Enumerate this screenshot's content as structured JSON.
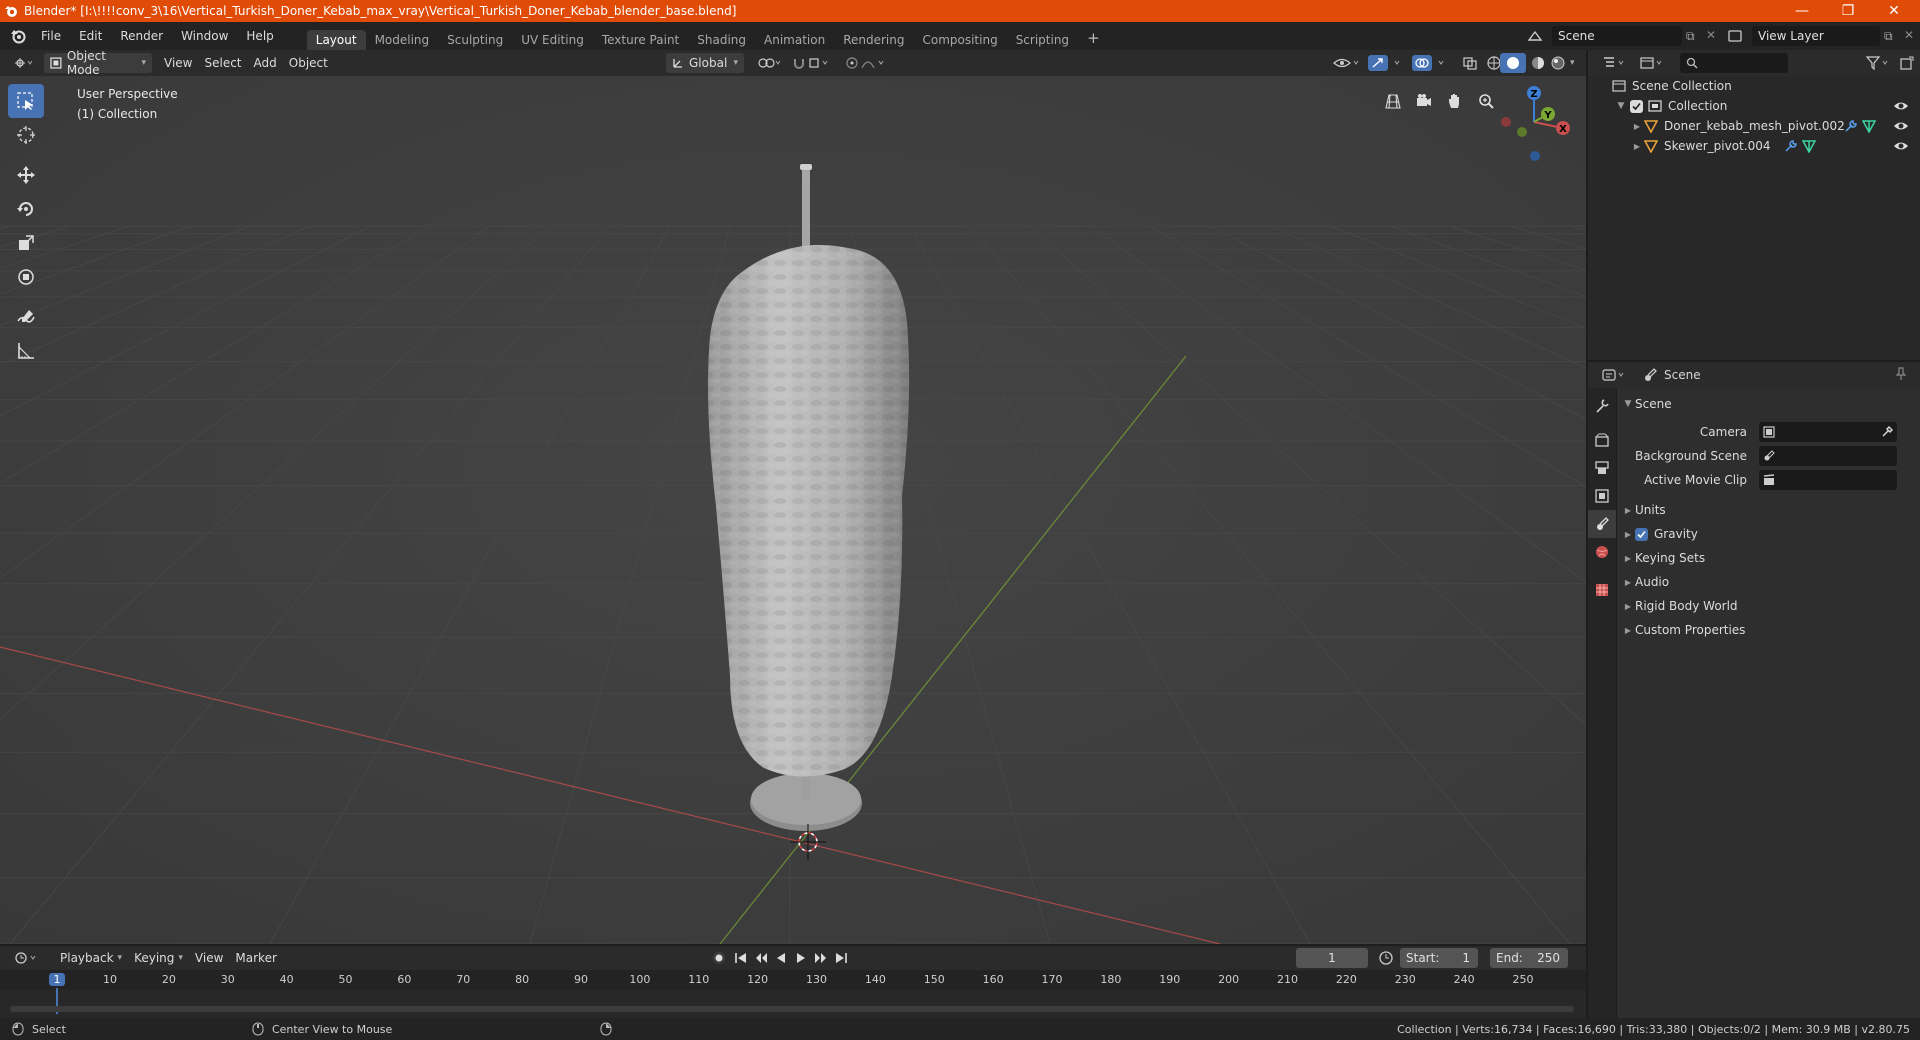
{
  "window": {
    "title": "Blender* [I:\\!!!!conv_3\\16\\Vertical_Turkish_Doner_Kebab_max_vray\\Vertical_Turkish_Doner_Kebab_blender_base.blend]"
  },
  "menu": [
    "File",
    "Edit",
    "Render",
    "Window",
    "Help"
  ],
  "workspaces": [
    "Layout",
    "Modeling",
    "Sculpting",
    "UV Editing",
    "Texture Paint",
    "Shading",
    "Animation",
    "Rendering",
    "Compositing",
    "Scripting"
  ],
  "active_workspace": "Layout",
  "scene_field": "Scene",
  "view_layer_field": "View Layer",
  "viewport_header": {
    "mode": "Object Mode",
    "menus": [
      "View",
      "Select",
      "Add",
      "Object"
    ],
    "transform_orientation": "Global"
  },
  "viewport": {
    "perspective_label": "User Perspective",
    "collection_label": "(1) Collection",
    "gizmo_axes": [
      "Z",
      "Y",
      "X"
    ]
  },
  "outliner": {
    "root": "Scene Collection",
    "collection": "Collection",
    "objects": [
      "Doner_kebab_mesh_pivot.002",
      "Skewer_pivot.004"
    ]
  },
  "properties": {
    "context": "Scene",
    "section": "Scene",
    "fields": [
      {
        "label": "Camera",
        "value": ""
      },
      {
        "label": "Background Scene",
        "value": ""
      },
      {
        "label": "Active Movie Clip",
        "value": ""
      }
    ],
    "panels": [
      "Units",
      "Gravity",
      "Keying Sets",
      "Audio",
      "Rigid Body World",
      "Custom Properties"
    ],
    "gravity_enabled": true
  },
  "timeline": {
    "menus": [
      "Playback",
      "Keying",
      "View",
      "Marker"
    ],
    "current_frame": "1",
    "start_label": "Start:",
    "start": "1",
    "end_label": "End:",
    "end": "250",
    "ruler": [
      "1",
      "10",
      "20",
      "30",
      "40",
      "50",
      "60",
      "70",
      "80",
      "90",
      "100",
      "110",
      "120",
      "130",
      "140",
      "150",
      "160",
      "170",
      "180",
      "190",
      "200",
      "210",
      "220",
      "230",
      "240",
      "250"
    ]
  },
  "status": {
    "left_action": "Select",
    "middle_action": "Center View to Mouse",
    "stats": "Collection | Verts:16,734 | Faces:16,690 | Tris:33,380 | Objects:0/2 | Mem: 30.9 MB | v2.80.75"
  },
  "colors": {
    "titlebar": "#e04b08",
    "accent": "#4772b3",
    "x_axis": "#c94e4e",
    "y_axis": "#7ba734",
    "z_axis": "#3d7fd6",
    "object_icon": "#e8a23a"
  }
}
